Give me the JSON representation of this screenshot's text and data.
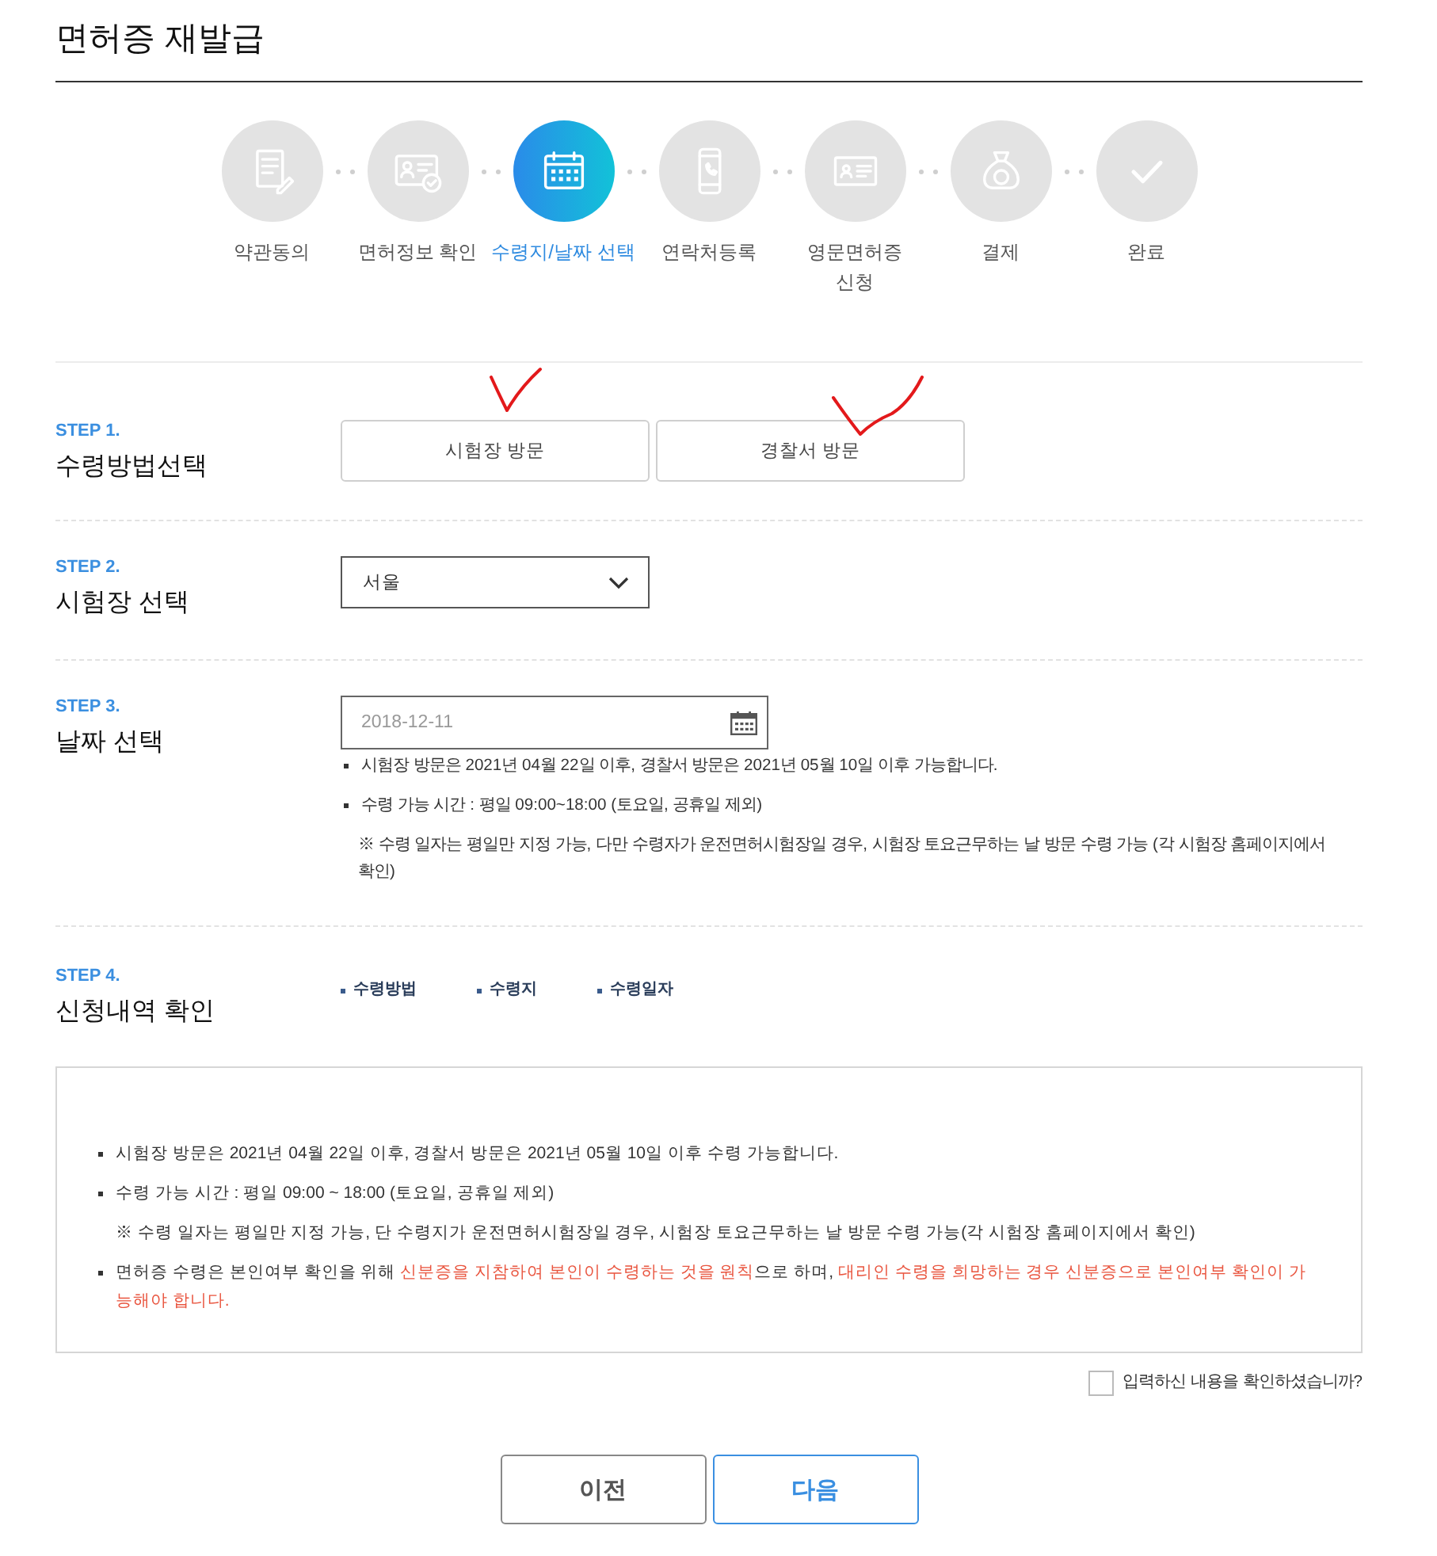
{
  "page_title": "면허증 재발급",
  "steps": [
    {
      "label": "약관동의",
      "selected": false
    },
    {
      "label": "면허정보 확인",
      "selected": false
    },
    {
      "label": "수령지/날짜 선택",
      "selected": true
    },
    {
      "label": "연락처등록",
      "selected": false
    },
    {
      "label": "영문면허증\n신청",
      "selected": false
    },
    {
      "label": "결제",
      "selected": false
    },
    {
      "label": "완료",
      "selected": false
    }
  ],
  "sections": [
    {
      "kind": "options",
      "step_label": "STEP 1.",
      "title": "수령방법선택",
      "options": [
        {
          "label": "시험장 방문",
          "selected": false,
          "annotated": true
        },
        {
          "label": "경찰서 방문",
          "selected": false,
          "annotated": true
        }
      ]
    },
    {
      "kind": "select",
      "step_label": "STEP 2.",
      "title": "시험장 선택",
      "select": {
        "value": "서울"
      }
    },
    {
      "kind": "date",
      "step_label": "STEP 3.",
      "title": "날짜 선택",
      "date_field": {
        "placeholder": "2018-12-11"
      },
      "notes": [
        {
          "kind": "bullet",
          "text": "시험장 방문은 2021년 04월 22일 이후, 경찰서 방문은 2021년 05월 10일 이후 가능합니다."
        },
        {
          "kind": "bullet",
          "text": "수령 가능 시간 : 평일 09:00~18:00 (토요일, 공휴일 제외)"
        },
        {
          "kind": "note",
          "text": "※ 수령 일자는 평일만 지정 가능, 다만 수령자가 운전면허시험장일 경우, 시험장 토요근무하는 날 방문 수령 가능 (각 시험장 홈페이지에서 확인)"
        }
      ]
    },
    {
      "kind": "summary",
      "step_label": "STEP 4.",
      "title": "신청내역 확인",
      "items": [
        "수령방법",
        "수령지",
        "수령일자"
      ]
    }
  ],
  "notice": {
    "items": [
      {
        "kind": "bullet",
        "segments": [
          {
            "text": "시험장 방문은 2021년 04월 22일 이후, 경찰서 방문은 2021년 05월 10일 이후 수령 가능합니다.",
            "highlight": false
          }
        ]
      },
      {
        "kind": "bullet",
        "segments": [
          {
            "text": "수령 가능 시간 : 평일 09:00 ~ 18:00 (토요일, 공휴일 제외)",
            "highlight": false
          }
        ]
      },
      {
        "kind": "note",
        "segments": [
          {
            "text": "※ 수령 일자는 평일만 지정 가능, 단 수령지가 운전면허시험장일 경우, 시험장 토요근무하는 날 방문 수령 가능(각 시험장 홈페이지에서 확인)",
            "highlight": false
          }
        ]
      },
      {
        "kind": "bullet",
        "segments": [
          {
            "text": "면허증 수령은 본인여부 확인을 위해 ",
            "highlight": false
          },
          {
            "text": "신분증을 지참하여 본인이 수령하는 것을 원칙",
            "highlight": true
          },
          {
            "text": "으로 하며, ",
            "highlight": false
          },
          {
            "text": "대리인 수령을 희망하는 경우 신분증으로 본인여부 확인이 가능해야 합니다.",
            "highlight": true
          }
        ]
      }
    ]
  },
  "confirm": {
    "label": "입력하신 내용을 확인하셨습니까?",
    "checked": false
  },
  "buttons": [
    {
      "label": "이전",
      "kind": "secondary"
    },
    {
      "label": "다음",
      "kind": "primary"
    }
  ]
}
